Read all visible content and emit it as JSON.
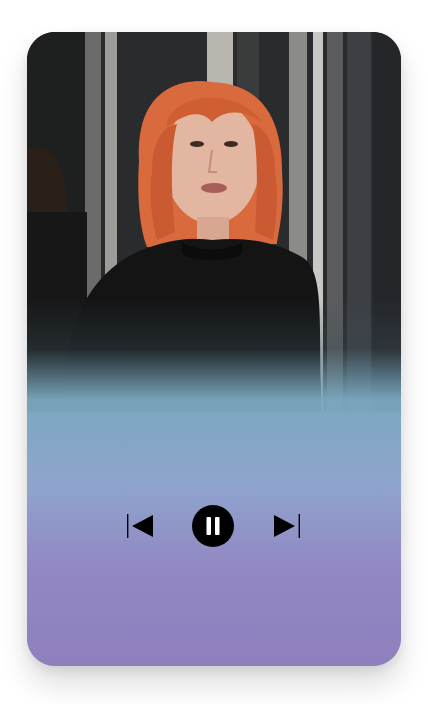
{
  "player": {
    "state": "playing",
    "colors": {
      "gradient_top": "#7ba9c0",
      "gradient_mid": "#8fa3cd",
      "gradient_bottom": "#8f7fbd",
      "icon": "#000000"
    },
    "controls": {
      "previous_icon": "skip-previous-icon",
      "pause_icon": "pause-icon",
      "next_icon": "skip-next-icon"
    }
  }
}
